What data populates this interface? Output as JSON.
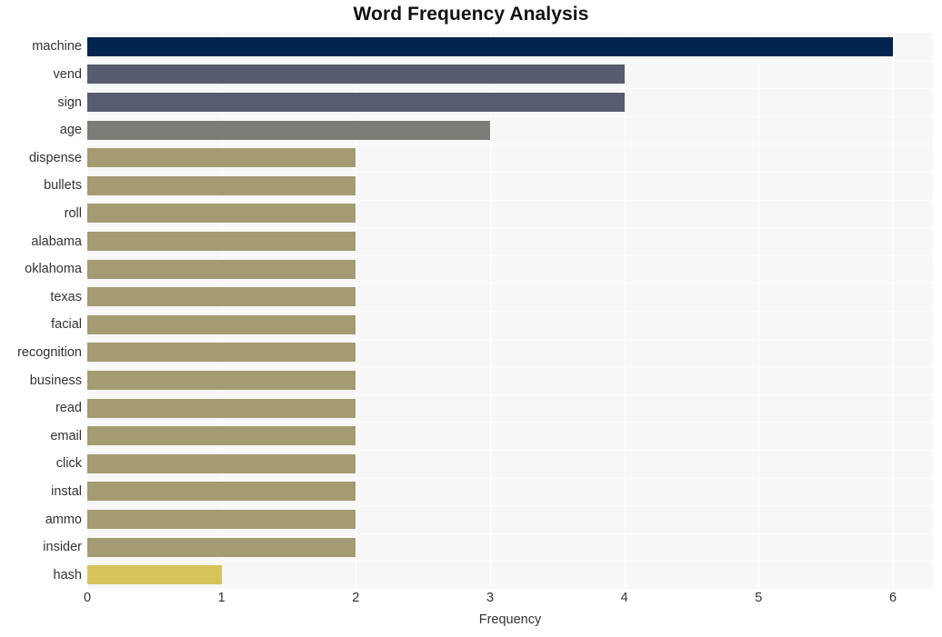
{
  "chart_data": {
    "type": "bar",
    "orientation": "horizontal",
    "title": "Word Frequency Analysis",
    "xlabel": "Frequency",
    "ylabel": "",
    "xlim": [
      0,
      6
    ],
    "xticks": [
      0,
      1,
      2,
      3,
      4,
      5,
      6
    ],
    "xtick_labels": [
      "0",
      "1",
      "2",
      "3",
      "4",
      "5",
      "6"
    ],
    "grid": true,
    "grid_axis": "x",
    "legend": false,
    "categories": [
      "machine",
      "vend",
      "sign",
      "age",
      "dispense",
      "bullets",
      "roll",
      "alabama",
      "oklahoma",
      "texas",
      "facial",
      "recognition",
      "business",
      "read",
      "email",
      "click",
      "instal",
      "ammo",
      "insider",
      "hash"
    ],
    "values": [
      6,
      4,
      4,
      3,
      2,
      2,
      2,
      2,
      2,
      2,
      2,
      2,
      2,
      2,
      2,
      2,
      2,
      2,
      2,
      1
    ],
    "bar_colors": [
      "#03244d",
      "#565b70",
      "#585c70",
      "#7b7b78",
      "#a39b71",
      "#a39b71",
      "#a39b71",
      "#a39b71",
      "#a39b71",
      "#a39b71",
      "#a39b71",
      "#a39b71",
      "#a39b71",
      "#a39b71",
      "#a39b71",
      "#a39b71",
      "#a39b71",
      "#a39b71",
      "#a39b71",
      "#d6c35a"
    ],
    "plot_background": "#f7f7f7",
    "gridline_color": "#ffffff",
    "figure_background": "#ffffff",
    "text_color": "#333333"
  }
}
